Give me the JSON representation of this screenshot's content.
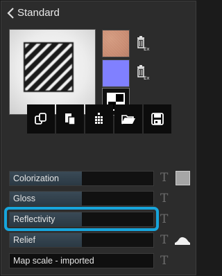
{
  "header": {
    "title": "Standard"
  },
  "toolbar": {
    "tools": [
      {
        "icon": "copy-icon"
      },
      {
        "icon": "paste-icon"
      },
      {
        "icon": "pixels-icon"
      },
      {
        "icon": "folder-open-icon"
      },
      {
        "icon": "save-icon"
      }
    ]
  },
  "maps": {
    "diffuse_color": "#c98c72",
    "normal_color": "#8080ff",
    "delete_label": "Ex"
  },
  "properties": {
    "colorization": {
      "label": "Colorization",
      "level": 0.5,
      "color": "#a6a6a6"
    },
    "gloss": {
      "label": "Gloss",
      "level": 0.5
    },
    "reflectivity": {
      "label": "Reflectivity",
      "level": 0.5
    },
    "relief": {
      "label": "Relief",
      "level": 0.5
    },
    "map_scale": {
      "label": "Map scale - imported"
    }
  },
  "highlight_color": "#17a5dc"
}
